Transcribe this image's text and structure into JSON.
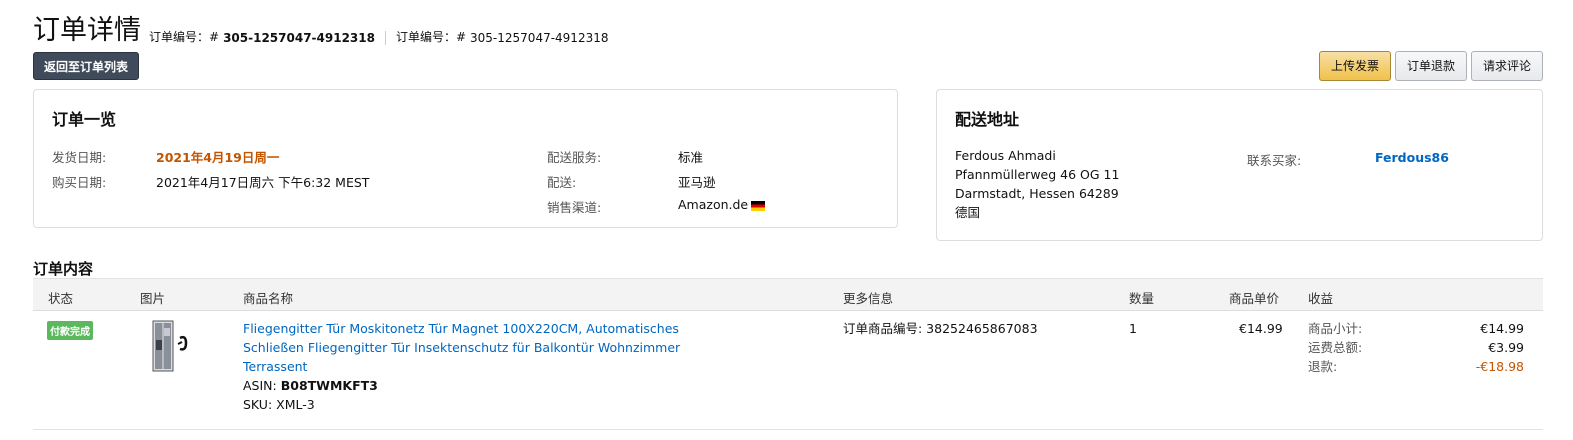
{
  "header": {
    "title": "订单详情",
    "order_label_1": "订单编号：#",
    "order_number_1": "305-1257047-4912318",
    "order_label_2": "订单编号：#",
    "order_number_2": "305-1257047-4912318",
    "back_button": "返回至订单列表"
  },
  "actions": {
    "upload_invoice": "上传发票",
    "refund": "订单退款",
    "request_review": "请求评论"
  },
  "summary": {
    "title": "订单一览",
    "ship_date_label": "发货日期:",
    "ship_date_value": "2021年4月19日周一",
    "purchase_date_label": "购买日期:",
    "purchase_date_value": "2021年4月17日周六 下午6:32 MEST",
    "service_label": "配送服务:",
    "service_value": "标准",
    "fulfillment_label": "配送:",
    "fulfillment_value": "亚马逊",
    "channel_label": "销售渠道:",
    "channel_value": "Amazon.de"
  },
  "shipping": {
    "title": "配送地址",
    "name": "Ferdous Ahmadi",
    "street": "Pfannmüllerweg 46 OG 11",
    "city": "Darmstadt, Hessen 64289",
    "country": "德国",
    "contact_label": "联系买家:",
    "buyer": "Ferdous86"
  },
  "items": {
    "title": "订单内容",
    "columns": [
      "状态",
      "图片",
      "商品名称",
      "更多信息",
      "数量",
      "商品单价",
      "收益"
    ],
    "row": {
      "status": "付款完成",
      "product_line1": "Fliegengitter Tür Moskitonetz Tür Magnet 100X220CM, Automatisches",
      "product_line2": "Schließen Fliegengitter Tür Insektenschutz für Balkontür Wohnzimmer",
      "product_line3": "Terrassent",
      "asin_label": "ASIN:",
      "asin": "B08TWMKFT3",
      "sku_label": "SKU:",
      "sku": "XML-3",
      "more_info": "订单商品编号: 38252465867083",
      "quantity": "1",
      "unit_price": "€14.99",
      "subtotal_label": "商品小计:",
      "subtotal": "€14.99",
      "shipping_label": "运费总额:",
      "shipping": "€3.99",
      "refund_label": "退款:",
      "refund": "-€18.98"
    }
  },
  "colors": {
    "accent_orange": "#c45500",
    "link": "#0066c0",
    "badge_green": "#5cb85c"
  }
}
